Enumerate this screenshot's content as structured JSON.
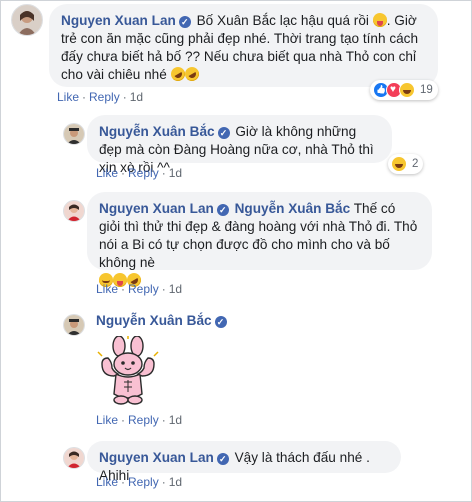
{
  "comments": [
    {
      "author": "Nguyen Xuan Lan",
      "text": "Bố Xuân Bắc lạc hậu quá rồi",
      "text2": ". Giờ trẻ con ăn mặc cũng phải đẹp nhé. Thời trang tạo tính cách đấy chưa biết hả bố ?? Nếu chưa biết qua nhà Thỏ con chỉ cho vài chiêu nhé",
      "like": "Like",
      "reply": "Reply",
      "time": "1d",
      "reaction_count": "19",
      "reaction_icons": [
        "like-icon",
        "love-icon",
        "haha-icon"
      ]
    },
    {
      "author": "Nguyễn Xuân Bắc",
      "text": "Giờ là không những đẹp mà còn Đàng Hoàng nữa cơ, nhà Thỏ thì xịn xò rồi ^^",
      "like": "Like",
      "reply": "Reply",
      "time": "1d",
      "reaction_count": "2",
      "reaction_icons": [
        "haha-icon"
      ]
    },
    {
      "author": "Nguyen Xuan Lan",
      "mention": "Nguyễn Xuân Bắc",
      "text": "Thế có giỏi thì thử thi đẹp & đàng hoàng với nhà Thỏ đi. Thỏ nói a Bi có tự chọn được đồ cho mình cho và bố không nè",
      "like": "Like",
      "reply": "Reply",
      "time": "1d"
    },
    {
      "author": "Nguyễn Xuân Bắc",
      "sticker": "bunny-flexing-sticker",
      "like": "Like",
      "reply": "Reply",
      "time": "1d"
    },
    {
      "author": "Nguyen Xuan Lan",
      "text": "Vậy là thách đấu nhé . Ahihi",
      "like": "Like",
      "reply": "Reply",
      "time": "1d"
    }
  ],
  "colors": {
    "name": "#385898",
    "link": "#4267b2",
    "bubble": "#f2f3f5",
    "meta": "#606770"
  }
}
